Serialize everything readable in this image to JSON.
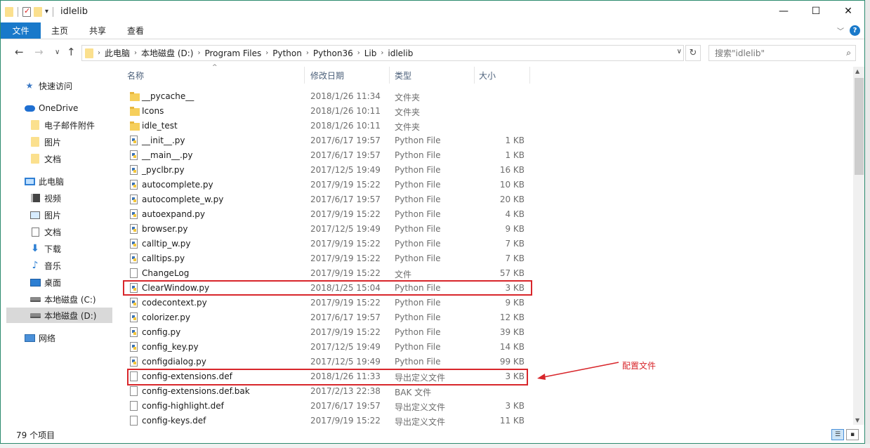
{
  "window": {
    "title": "idlelib",
    "controls": {
      "minimize": "—",
      "maximize": "☐",
      "close": "✕"
    }
  },
  "ribbon": {
    "file_tab": "文件",
    "tabs": [
      "主页",
      "共享",
      "查看"
    ]
  },
  "address": {
    "breadcrumbs": [
      "此电脑",
      "本地磁盘 (D:)",
      "Program Files",
      "Python",
      "Python36",
      "Lib",
      "idlelib"
    ],
    "search_placeholder": "搜索\"idlelib\""
  },
  "nav": {
    "quick_access": "快速访问",
    "onedrive": "OneDrive",
    "onedrive_children": [
      "电子邮件附件",
      "图片",
      "文档"
    ],
    "this_pc": "此电脑",
    "this_pc_children": [
      "视频",
      "图片",
      "文档",
      "下载",
      "音乐",
      "桌面",
      "本地磁盘 (C:)",
      "本地磁盘 (D:)"
    ],
    "network": "网络"
  },
  "columns": {
    "name": "名称",
    "date": "修改日期",
    "type": "类型",
    "size": "大小"
  },
  "files": [
    {
      "name": "__pycache__",
      "date": "2018/1/26 11:34",
      "type": "文件夹",
      "size": "",
      "kind": "folder"
    },
    {
      "name": "Icons",
      "date": "2018/1/26 10:11",
      "type": "文件夹",
      "size": "",
      "kind": "folder"
    },
    {
      "name": "idle_test",
      "date": "2018/1/26 10:11",
      "type": "文件夹",
      "size": "",
      "kind": "folder"
    },
    {
      "name": "__init__.py",
      "date": "2017/6/17 19:57",
      "type": "Python File",
      "size": "1 KB",
      "kind": "py"
    },
    {
      "name": "__main__.py",
      "date": "2017/6/17 19:57",
      "type": "Python File",
      "size": "1 KB",
      "kind": "py"
    },
    {
      "name": "_pyclbr.py",
      "date": "2017/12/5 19:49",
      "type": "Python File",
      "size": "16 KB",
      "kind": "py"
    },
    {
      "name": "autocomplete.py",
      "date": "2017/9/19 15:22",
      "type": "Python File",
      "size": "10 KB",
      "kind": "py"
    },
    {
      "name": "autocomplete_w.py",
      "date": "2017/6/17 19:57",
      "type": "Python File",
      "size": "20 KB",
      "kind": "py"
    },
    {
      "name": "autoexpand.py",
      "date": "2017/9/19 15:22",
      "type": "Python File",
      "size": "4 KB",
      "kind": "py"
    },
    {
      "name": "browser.py",
      "date": "2017/12/5 19:49",
      "type": "Python File",
      "size": "9 KB",
      "kind": "py"
    },
    {
      "name": "calltip_w.py",
      "date": "2017/9/19 15:22",
      "type": "Python File",
      "size": "7 KB",
      "kind": "py"
    },
    {
      "name": "calltips.py",
      "date": "2017/9/19 15:22",
      "type": "Python File",
      "size": "7 KB",
      "kind": "py"
    },
    {
      "name": "ChangeLog",
      "date": "2017/9/19 15:22",
      "type": "文件",
      "size": "57 KB",
      "kind": "txt"
    },
    {
      "name": "ClearWindow.py",
      "date": "2018/1/25 15:04",
      "type": "Python File",
      "size": "3 KB",
      "kind": "py"
    },
    {
      "name": "codecontext.py",
      "date": "2017/9/19 15:22",
      "type": "Python File",
      "size": "9 KB",
      "kind": "py"
    },
    {
      "name": "colorizer.py",
      "date": "2017/6/17 19:57",
      "type": "Python File",
      "size": "12 KB",
      "kind": "py"
    },
    {
      "name": "config.py",
      "date": "2017/9/19 15:22",
      "type": "Python File",
      "size": "39 KB",
      "kind": "py"
    },
    {
      "name": "config_key.py",
      "date": "2017/12/5 19:49",
      "type": "Python File",
      "size": "14 KB",
      "kind": "py"
    },
    {
      "name": "configdialog.py",
      "date": "2017/12/5 19:49",
      "type": "Python File",
      "size": "99 KB",
      "kind": "py"
    },
    {
      "name": "config-extensions.def",
      "date": "2018/1/26 11:33",
      "type": "导出定义文件",
      "size": "3 KB",
      "kind": "txt"
    },
    {
      "name": "config-extensions.def.bak",
      "date": "2017/2/13 22:38",
      "type": "BAK 文件",
      "size": "",
      "kind": "txt"
    },
    {
      "name": "config-highlight.def",
      "date": "2017/6/17 19:57",
      "type": "导出定义文件",
      "size": "3 KB",
      "kind": "txt"
    },
    {
      "name": "config-keys.def",
      "date": "2017/9/19 15:22",
      "type": "导出定义文件",
      "size": "11 KB",
      "kind": "txt"
    }
  ],
  "annotation": {
    "text": "配置文件",
    "color": "#d8262b"
  },
  "status": {
    "count": "79 个项目"
  },
  "colors": {
    "accent": "#1979ca",
    "highlight": "#d8262b",
    "selected_nav": "#d9d9d9"
  }
}
